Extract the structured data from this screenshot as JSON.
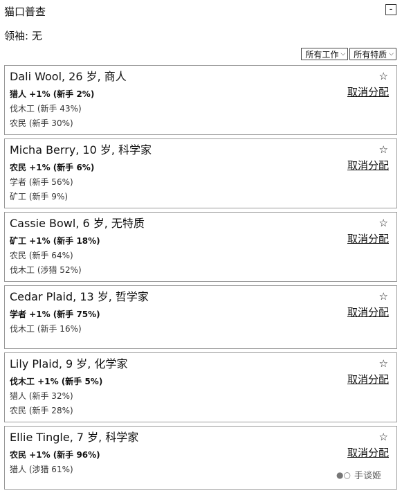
{
  "header": {
    "title": "猫口普查",
    "collapse_label": "-"
  },
  "leader": {
    "text": "领袖: 无"
  },
  "filters": {
    "job": {
      "label": "所有工作",
      "icon": "chevron-down-icon"
    },
    "trait": {
      "label": "所有特质",
      "icon": "chevron-down-icon"
    }
  },
  "cats": [
    {
      "title": "Dali Wool, 26 岁, 商人",
      "job": "猎人 +1% (新手 2%)",
      "others": [
        "伐木工 (新手 43%)",
        "农民 (新手 30%)"
      ],
      "star": "☆",
      "action": "取消分配"
    },
    {
      "title": "Micha Berry, 10 岁, 科学家",
      "job": "农民 +1% (新手 6%)",
      "others": [
        "学者 (新手 56%)",
        "矿工 (新手 9%)"
      ],
      "star": "☆",
      "action": "取消分配"
    },
    {
      "title": "Cassie Bowl, 6 岁, 无特质",
      "job": "矿工 +1% (新手 18%)",
      "others": [
        "农民 (新手 64%)",
        "伐木工 (涉猎 52%)"
      ],
      "star": "☆",
      "action": "取消分配"
    },
    {
      "title": "Cedar Plaid, 13 岁, 哲学家",
      "job": "学者 +1% (新手 75%)",
      "others": [
        "伐木工 (新手 16%)"
      ],
      "star": "☆",
      "action": "取消分配"
    },
    {
      "title": "Lily Plaid, 9 岁, 化学家",
      "job": "伐木工 +1% (新手 5%)",
      "others": [
        "猎人 (新手 32%)",
        "农民 (新手 28%)"
      ],
      "star": "☆",
      "action": "取消分配"
    },
    {
      "title": "Ellie Tingle, 7 岁, 科学家",
      "job": "农民 +1% (新手 96%)",
      "others": [
        "猎人 (涉猎 61%)"
      ],
      "star": "☆",
      "action": "取消分配"
    }
  ],
  "watermark": {
    "text": "手谈姬",
    "icon": "chat-bubble-icon"
  }
}
